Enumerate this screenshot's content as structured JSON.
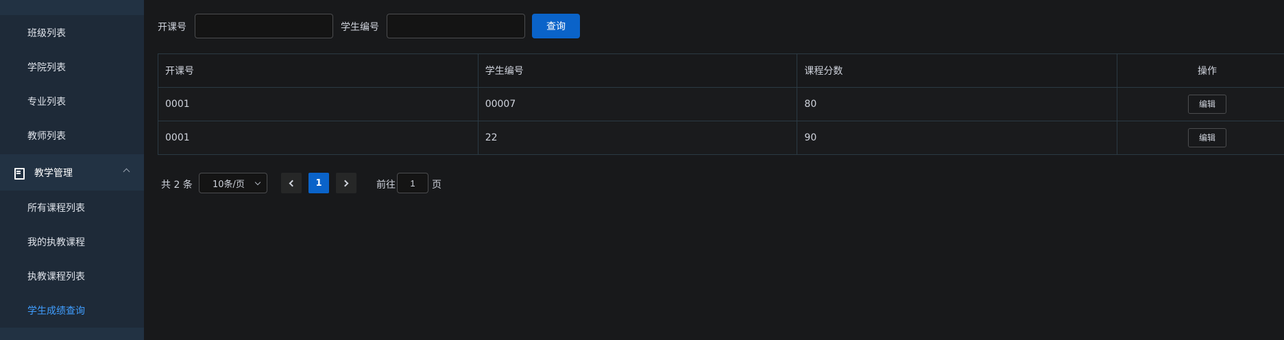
{
  "sidebar": {
    "items_top": [
      {
        "label": "班级列表"
      },
      {
        "label": "学院列表"
      },
      {
        "label": "专业列表"
      },
      {
        "label": "教师列表"
      }
    ],
    "group": {
      "label": "教学管理"
    },
    "items_group": [
      {
        "label": "所有课程列表"
      },
      {
        "label": "我的执教课程"
      },
      {
        "label": "执教课程列表"
      },
      {
        "label": "学生成绩查询",
        "active": true
      }
    ]
  },
  "search": {
    "course_label": "开课号",
    "course_value": "",
    "student_label": "学生编号",
    "student_value": "",
    "query_button": "查询"
  },
  "table": {
    "headers": [
      "开课号",
      "学生编号",
      "课程分数",
      "操作"
    ],
    "rows": [
      {
        "course_no": "0001",
        "student_no": "00007",
        "score": "80",
        "action": "编辑"
      },
      {
        "course_no": "0001",
        "student_no": "22",
        "score": "90",
        "action": "编辑"
      }
    ]
  },
  "pagination": {
    "total": "共 2 条",
    "page_size": "10条/页",
    "current_page": "1",
    "goto_label": "前往",
    "goto_value": "1",
    "goto_suffix": "页"
  },
  "colors": {
    "sidebar_bg": "#1e2a38",
    "active": "#409eff",
    "primary": "#0a63c9",
    "page_bg": "#18191b"
  }
}
